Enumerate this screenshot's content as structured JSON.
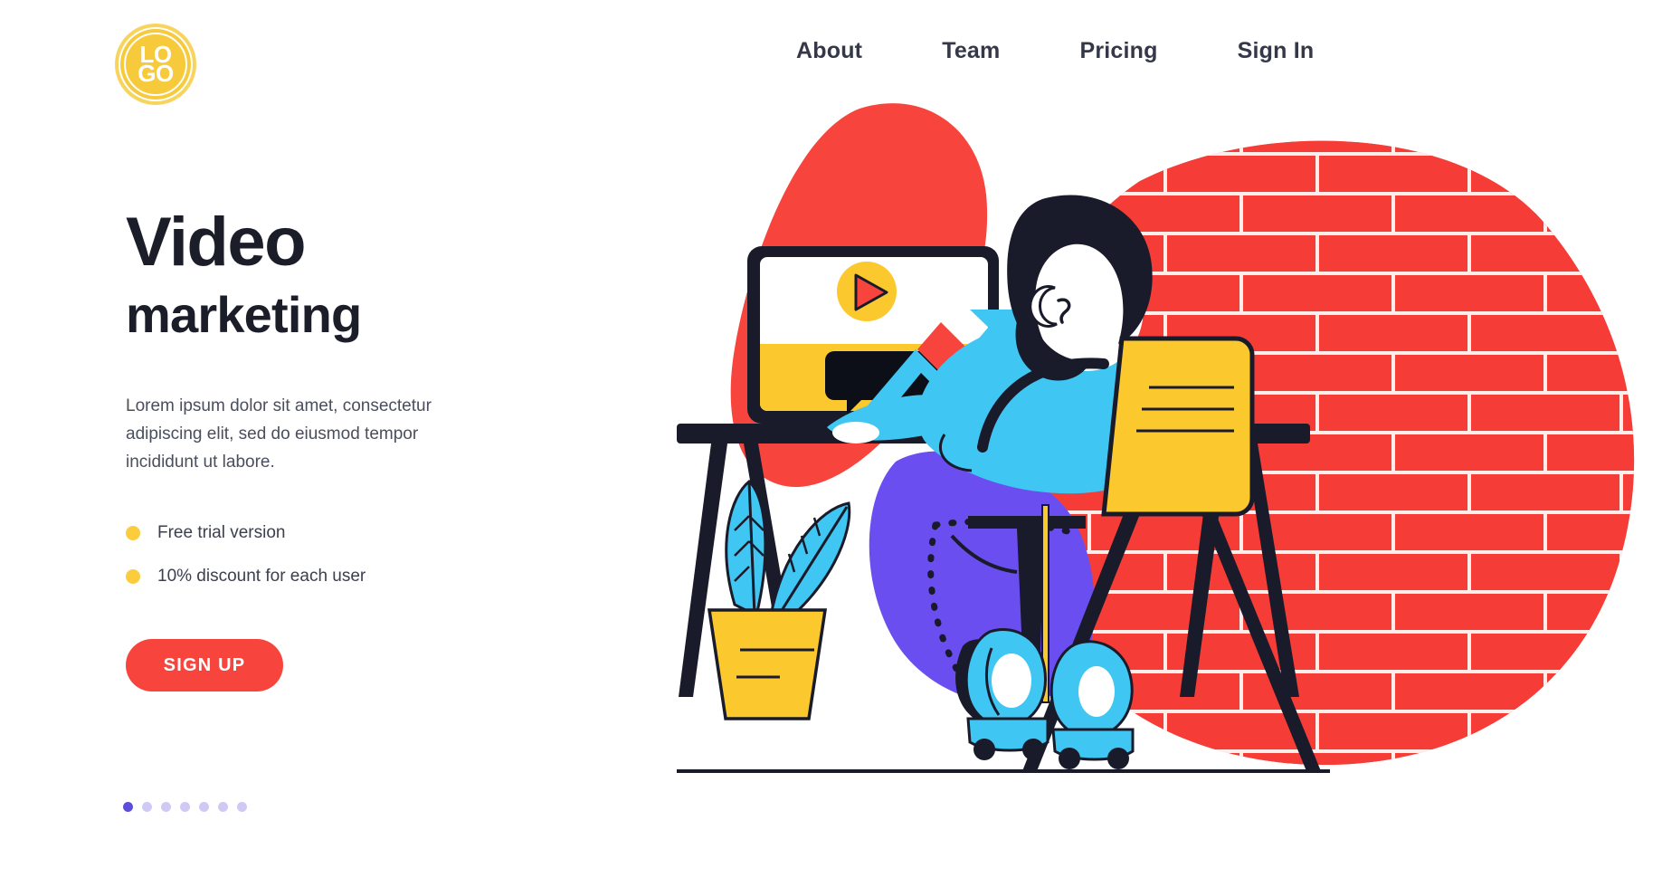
{
  "brand": {
    "logo_line1": "LO",
    "logo_line2": "GO",
    "logo_icon": "logo-circle-icon",
    "logo_color": "#f6ca3a"
  },
  "nav": {
    "items": [
      {
        "label": "About"
      },
      {
        "label": "Team"
      },
      {
        "label": "Pricing"
      },
      {
        "label": "Sign In"
      }
    ]
  },
  "hero": {
    "title_line1": "Video",
    "title_line2": "marketing",
    "paragraph": "Lorem ipsum dolor sit amet, consectetur adipiscing elit, sed do eiusmod tempor incididunt ut labore.",
    "features": [
      {
        "label": "Free trial version",
        "bullet_icon": "dot-icon"
      },
      {
        "label": "10% discount for each user",
        "bullet_icon": "dot-icon"
      }
    ],
    "cta_label": "SIGN UP",
    "cta_color": "#f7443d"
  },
  "carousel": {
    "total_dots": 7,
    "active_index": 0,
    "active_color": "#5c4ddb",
    "inactive_color": "#cfcaf4"
  },
  "illustration": {
    "name": "video-marketing-illustration",
    "description": "Man seated at desk in yellow chair watching a video on a monitor, red brick wall behind, potted plant beside desk",
    "colors": {
      "red": "#f7443d",
      "brick_red": "#f63c36",
      "mortar": "#fdeeea",
      "yellow": "#fbc82e",
      "blue": "#3fc6f2",
      "purple": "#6b4ef0",
      "navy": "#191b2a",
      "skin": "#ffffff",
      "white": "#ffffff"
    },
    "elements": [
      "monitor-screen",
      "play-button-icon",
      "speech-bubble",
      "growth-arrow-icon",
      "desk",
      "office-chair",
      "potted-plant",
      "brick-wall",
      "seated-person"
    ]
  }
}
